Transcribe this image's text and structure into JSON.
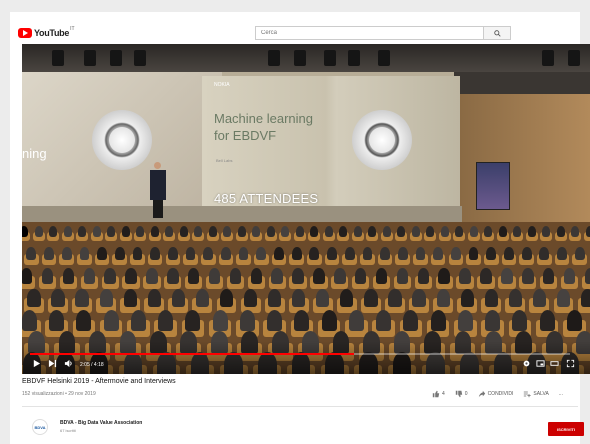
{
  "header": {
    "logo_text": "YouTube",
    "logo_country": "IT",
    "search_placeholder": "Cerca"
  },
  "video": {
    "slide_logo": "NOKIA",
    "slide_title_line1": "Machine learning",
    "slide_title_line2": "for EBDVF",
    "slide_sub": "Bell Labs",
    "left_screen_text": "ning",
    "overlay_text": "485 ATTENDEES",
    "progress": 0.6,
    "time_display": "2:05 / 4:18"
  },
  "info": {
    "title": "EBDVF Helsinki 2019 - Aftermovie and Interviews",
    "meta": "152 visualizzazioni • 29 nov 2019",
    "likes": "4",
    "dislikes": "0",
    "share_label": "CONDIVIDI",
    "save_label": "SALVA",
    "more_label": "..."
  },
  "channel": {
    "avatar_text": "BDVA",
    "name": "BDVA - Big Data Value Association",
    "subscribers": "67 iscritti",
    "subscribe_label": "ISCRIVITI"
  },
  "colors": {
    "brand_red": "#ff0000",
    "subscribe_red": "#cc0000"
  }
}
